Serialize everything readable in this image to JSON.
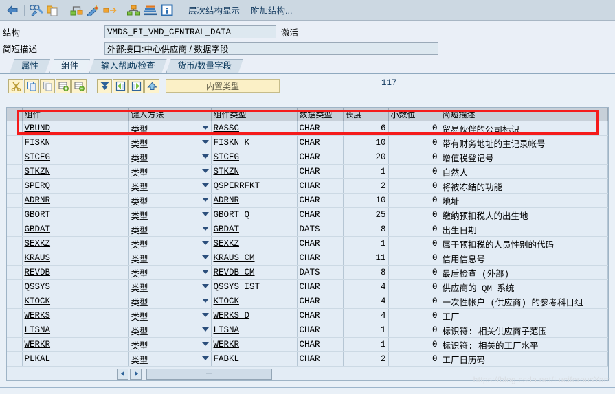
{
  "toolbar": {
    "icons": [
      {
        "name": "back-arrow-icon",
        "title": "返回"
      },
      {
        "name": "glasses-pencil-icon",
        "title": "显示/修改"
      },
      {
        "name": "copy-folder-icon",
        "title": "复制"
      },
      {
        "name": "where-used-icon",
        "title": "使用列表"
      },
      {
        "name": "magic-wand-icon",
        "title": "生成"
      },
      {
        "name": "navigate-icon",
        "title": "导航"
      },
      {
        "name": "hierarchy-icon",
        "title": "层次"
      },
      {
        "name": "stack-icon",
        "title": "堆栈"
      },
      {
        "name": "info-icon",
        "title": "信息"
      }
    ],
    "buttons": [
      {
        "label": "层次结构显示"
      },
      {
        "label": "附加结构..."
      }
    ]
  },
  "header": {
    "structure_label": "结构",
    "structure_value": "VMDS_EI_VMD_CENTRAL_DATA",
    "status": "激活",
    "description_label": "简短描述",
    "description_value": "外部接口:中心供应商 / 数据字段"
  },
  "tabs": [
    {
      "label": "属性",
      "active": false
    },
    {
      "label": "组件",
      "active": true
    },
    {
      "label": "输入帮助/检查",
      "active": false
    },
    {
      "label": "货币/数量字段",
      "active": false
    }
  ],
  "grid_toolbar": {
    "icons": [
      {
        "name": "cut-icon"
      },
      {
        "name": "copy-icon"
      },
      {
        "name": "paste-icon"
      },
      {
        "name": "insert-row-icon"
      },
      {
        "name": "delete-row-icon"
      },
      {
        "name": "sort-down-icon"
      },
      {
        "name": "expand-icon"
      },
      {
        "name": "collapse-icon"
      },
      {
        "name": "up-arrow-icon"
      }
    ],
    "builtin_type_label": "内置类型",
    "counter": "117"
  },
  "grid": {
    "columns": [
      "组件",
      "键入方法",
      "组件类型",
      "数据类型",
      "长度",
      "小数位",
      "简短描述"
    ],
    "type_method_value": "类型",
    "rows": [
      {
        "component": "VBUND",
        "method": "类型",
        "comp_type": "RASSC",
        "data_type": "CHAR",
        "length": "6",
        "decimals": "0",
        "description": "贸易伙伴的公司标识"
      },
      {
        "component": "FISKN",
        "method": "类型",
        "comp_type": "FISKN_K",
        "data_type": "CHAR",
        "length": "10",
        "decimals": "0",
        "description": "带有财务地址的主记录帐号"
      },
      {
        "component": "STCEG",
        "method": "类型",
        "comp_type": "STCEG",
        "data_type": "CHAR",
        "length": "20",
        "decimals": "0",
        "description": "增值税登记号"
      },
      {
        "component": "STKZN",
        "method": "类型",
        "comp_type": "STKZN",
        "data_type": "CHAR",
        "length": "1",
        "decimals": "0",
        "description": "自然人"
      },
      {
        "component": "SPERQ",
        "method": "类型",
        "comp_type": "QSPERRFKT",
        "data_type": "CHAR",
        "length": "2",
        "decimals": "0",
        "description": "将被冻结的功能"
      },
      {
        "component": "ADRNR",
        "method": "类型",
        "comp_type": "ADRNR",
        "data_type": "CHAR",
        "length": "10",
        "decimals": "0",
        "description": "地址"
      },
      {
        "component": "GBORT",
        "method": "类型",
        "comp_type": "GBORT_Q",
        "data_type": "CHAR",
        "length": "25",
        "decimals": "0",
        "description": "缴纳预扣税人的出生地"
      },
      {
        "component": "GBDAT",
        "method": "类型",
        "comp_type": "GBDAT",
        "data_type": "DATS",
        "length": "8",
        "decimals": "0",
        "description": "出生日期"
      },
      {
        "component": "SEXKZ",
        "method": "类型",
        "comp_type": "SEXKZ",
        "data_type": "CHAR",
        "length": "1",
        "decimals": "0",
        "description": "属于预扣税的人员性别的代码"
      },
      {
        "component": "KRAUS",
        "method": "类型",
        "comp_type": "KRAUS_CM",
        "data_type": "CHAR",
        "length": "11",
        "decimals": "0",
        "description": "信用信息号"
      },
      {
        "component": "REVDB",
        "method": "类型",
        "comp_type": "REVDB_CM",
        "data_type": "DATS",
        "length": "8",
        "decimals": "0",
        "description": "最后检查 (外部)"
      },
      {
        "component": "QSSYS",
        "method": "类型",
        "comp_type": "QSSYS_IST",
        "data_type": "CHAR",
        "length": "4",
        "decimals": "0",
        "description": "供应商的 QM 系统"
      },
      {
        "component": "KTOCK",
        "method": "类型",
        "comp_type": "KTOCK",
        "data_type": "CHAR",
        "length": "4",
        "decimals": "0",
        "description": "一次性帐户 (供应商) 的参考科目组"
      },
      {
        "component": "WERKS",
        "method": "类型",
        "comp_type": "WERKS_D",
        "data_type": "CHAR",
        "length": "4",
        "decimals": "0",
        "description": "工厂"
      },
      {
        "component": "LTSNA",
        "method": "类型",
        "comp_type": "LTSNA",
        "data_type": "CHAR",
        "length": "1",
        "decimals": "0",
        "description": "标识符: 相关供应商子范围"
      },
      {
        "component": "WERKR",
        "method": "类型",
        "comp_type": "WERKR",
        "data_type": "CHAR",
        "length": "1",
        "decimals": "0",
        "description": "标识符: 相关的工厂水平"
      },
      {
        "component": "PLKAL",
        "method": "类型",
        "comp_type": "FABKL",
        "data_type": "CHAR",
        "length": "2",
        "decimals": "0",
        "description": "工厂日历码"
      }
    ]
  },
  "scrollbar": {
    "left_arrow": "◀",
    "right_arrow": "▶",
    "grip": "⋯"
  },
  "watermark": "https://blog.csdn.net/LuciferousYam",
  "colors": {
    "toolbar_bg": "#ccd8e2",
    "panel_bg": "#e9f0f7",
    "grid_header": "#c7d0d9",
    "grid_cell": "#e3ecf5",
    "accent_red": "#f51b1b",
    "button_yellow": "#fbf0c6"
  }
}
